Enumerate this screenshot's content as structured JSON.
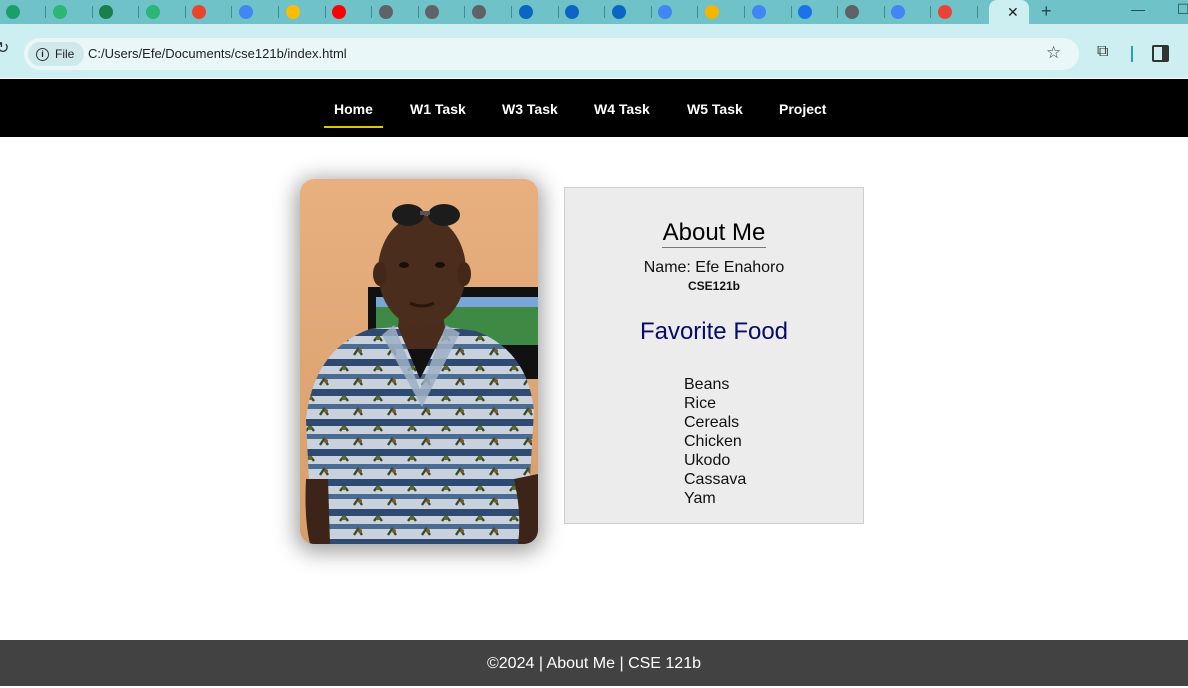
{
  "browser": {
    "tab_favicon_colors": [
      "#1a9e6a",
      "#2bb673",
      "#1a7f4b",
      "#2bb673",
      "#e8452c",
      "#4285f4",
      "#fbbc05",
      "#ff0000",
      "#5f6368",
      "#5f6368",
      "#5f6368",
      "#0a66c2",
      "#0a66c2",
      "#0a66c2",
      "#4285f4",
      "#f5b400",
      "#4285f4",
      "#1a73e8",
      "#5f6368",
      "#4285f4",
      "#ea4335"
    ],
    "active_tab_close": "✕",
    "new_tab": "+",
    "minimize": "—",
    "maximize": "☐",
    "site_info_label": "File",
    "url": "C:/Users/Efe/Documents/cse121b/index.html"
  },
  "nav": {
    "items": [
      {
        "label": "Home",
        "current": true
      },
      {
        "label": "W1 Task"
      },
      {
        "label": "W3 Task"
      },
      {
        "label": "W4 Task"
      },
      {
        "label": "W5 Task"
      },
      {
        "label": "Project"
      }
    ]
  },
  "about": {
    "title": "About Me",
    "name_line": "Name: Efe Enahoro",
    "course": "CSE121b",
    "food_title": "Favorite Food",
    "foods": [
      "Beans",
      "Rice",
      "Cereals",
      "Chicken",
      "Ukodo",
      "Cassava",
      "Yam"
    ]
  },
  "footer": {
    "text": "©2024 | About Me | CSE 121b"
  },
  "colors": {
    "tabstrip": "#6fc3c8",
    "toolbar": "#cdeff1",
    "nav_bg": "#000000",
    "nav_active_underline": "#e8c300",
    "food_title": "#0a0a6a",
    "footer_bg": "#424242"
  }
}
